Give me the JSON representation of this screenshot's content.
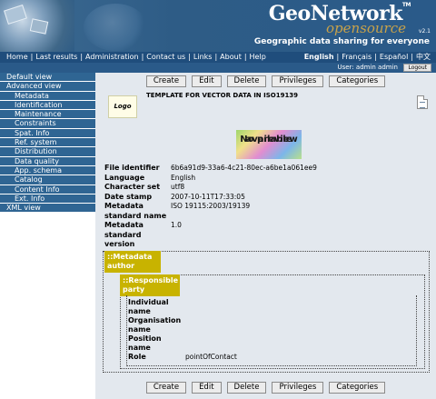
{
  "header": {
    "logo_main": "GeoNetwork",
    "logo_tm": "TM",
    "logo_sub": "opensource",
    "logo_version": "v2.1",
    "tagline": "Geographic data sharing for everyone"
  },
  "nav": {
    "items": [
      "Home",
      "Last results",
      "Administration",
      "Contact us",
      "Links",
      "About",
      "Help"
    ],
    "languages": [
      "English",
      "Français",
      "Español",
      "中文"
    ],
    "active_language": "English"
  },
  "user": {
    "label": "User: admin admin",
    "logout": "Logout"
  },
  "sidebar": {
    "items": [
      {
        "label": "Default view",
        "sub": false
      },
      {
        "label": "Advanced view",
        "sub": false
      },
      {
        "label": "Metadata",
        "sub": true
      },
      {
        "label": "Identification",
        "sub": true
      },
      {
        "label": "Maintenance",
        "sub": true
      },
      {
        "label": "Constraints",
        "sub": true
      },
      {
        "label": "Spat. Info",
        "sub": true
      },
      {
        "label": "Ref. system",
        "sub": true
      },
      {
        "label": "Distribution",
        "sub": true
      },
      {
        "label": "Data quality",
        "sub": true
      },
      {
        "label": "App. schema",
        "sub": true
      },
      {
        "label": "Catalog",
        "sub": true
      },
      {
        "label": "Content Info",
        "sub": true
      },
      {
        "label": "Ext. Info",
        "sub": true
      },
      {
        "label": "XML view",
        "sub": false
      }
    ]
  },
  "buttons": [
    "Create",
    "Edit",
    "Delete",
    "Privileges",
    "Categories"
  ],
  "record": {
    "logo_text": "Logo",
    "title": "TEMPLATE FOR VECTOR DATA IN ISO19139",
    "preview_line1": "No preview",
    "preview_line2": "available",
    "fields": [
      {
        "label": "File identifier",
        "value": "6b6a91d9-33a6-4c21-80ec-a6be1a061ee9"
      },
      {
        "label": "Language",
        "value": "English"
      },
      {
        "label": "Character set",
        "value": "utf8"
      },
      {
        "label": "Date stamp",
        "value": "2007-10-11T17:33:05"
      },
      {
        "label": "Metadata standard name",
        "value": "ISO 19115:2003/19139"
      },
      {
        "label": "Metadata standard version",
        "value": "1.0"
      }
    ],
    "section_author": "::Metadata author",
    "section_party": "::Responsible party",
    "party_fields": [
      {
        "label": "Individual name",
        "value": ""
      },
      {
        "label": "Organisation name",
        "value": ""
      },
      {
        "label": "Position name",
        "value": ""
      },
      {
        "label": "Role",
        "value": "pointOfContact"
      }
    ]
  }
}
